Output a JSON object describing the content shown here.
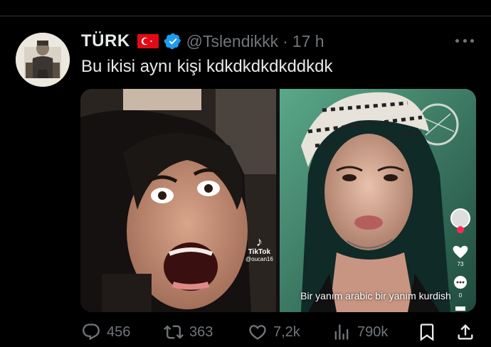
{
  "tweet": {
    "display_name": "TÜRK",
    "handle": "@Tslendikkk",
    "separator": "·",
    "time": "17 h",
    "text": "Bu ikisi aynı kişi kdkdkdkdkddkdk"
  },
  "media": {
    "watermark_brand": "TikTok",
    "watermark_user": "@oucan16",
    "caption": "Bir yanım arabic bir yanım kurdish",
    "side_like_count": "73",
    "side_comment_count": "0"
  },
  "actions": {
    "replies": "456",
    "reposts": "363",
    "likes": "7,2k",
    "views": "790k"
  },
  "colors": {
    "background": "#000000",
    "text_primary": "#e7e9ea",
    "text_secondary": "#71767b",
    "verified_blue": "#1d9bf0",
    "flag_red": "#e30a17"
  },
  "icons": [
    "verified-badge-icon",
    "more-icon",
    "reply-icon",
    "repost-icon",
    "like-icon",
    "views-icon",
    "bookmark-icon",
    "share-icon"
  ]
}
